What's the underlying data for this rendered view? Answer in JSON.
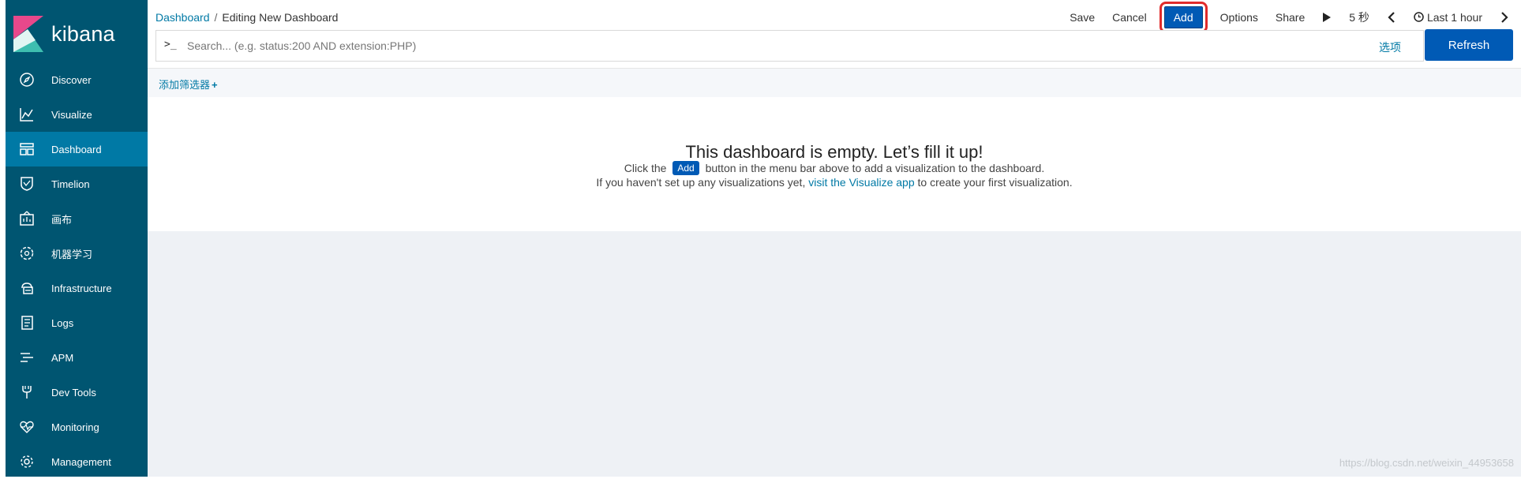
{
  "brand": {
    "name": "kibana"
  },
  "sidebar": {
    "items": [
      {
        "label": "Discover",
        "icon": "compass-icon"
      },
      {
        "label": "Visualize",
        "icon": "chart-icon"
      },
      {
        "label": "Dashboard",
        "icon": "dashboard-icon",
        "active": true
      },
      {
        "label": "Timelion",
        "icon": "shield-icon"
      },
      {
        "label": "画布",
        "icon": "canvas-icon"
      },
      {
        "label": "机器学习",
        "icon": "ml-icon"
      },
      {
        "label": "Infrastructure",
        "icon": "infrastructure-icon"
      },
      {
        "label": "Logs",
        "icon": "logs-icon"
      },
      {
        "label": "APM",
        "icon": "apm-icon"
      },
      {
        "label": "Dev Tools",
        "icon": "wrench-icon"
      },
      {
        "label": "Monitoring",
        "icon": "heartbeat-icon"
      },
      {
        "label": "Management",
        "icon": "gear-icon"
      }
    ]
  },
  "breadcrumb": {
    "root": "Dashboard",
    "separator": "/",
    "current": "Editing New Dashboard"
  },
  "menu": {
    "save": "Save",
    "cancel": "Cancel",
    "add": "Add",
    "options": "Options",
    "share": "Share",
    "interval": "5 秒",
    "time_range": "Last 1 hour"
  },
  "search": {
    "prompt": ">_",
    "placeholder": "Search... (e.g. status:200 AND extension:PHP)",
    "options": "选项",
    "refresh": "Refresh"
  },
  "filter": {
    "add_label": "添加筛选器",
    "plus": "+"
  },
  "empty": {
    "title": "This dashboard is empty. Let’s fill it up!",
    "line1_pre": "Click the",
    "line1_button": "Add",
    "line1_post": "button in the menu bar above to add a visualization to the dashboard.",
    "line2_pre": "If you haven't set up any visualizations yet,",
    "line2_link": "visit the Visualize app",
    "line2_post": "to create your first visualization."
  },
  "watermark": "https://blog.csdn.net/weixin_44953658",
  "colors": {
    "sidebar": "#005571",
    "sidebar_active": "#0079a5",
    "primary": "#005ab5",
    "link": "#0079a5",
    "highlight": "#e12b2b"
  }
}
